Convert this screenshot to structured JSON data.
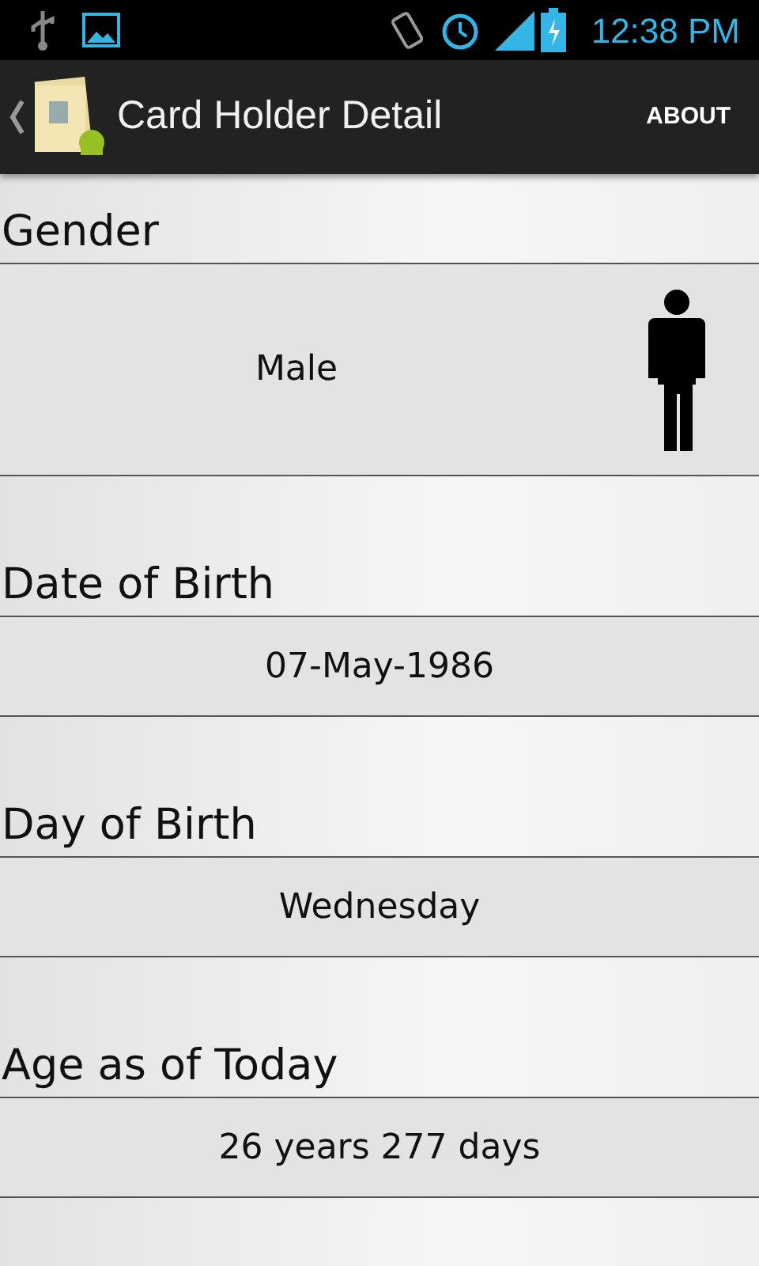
{
  "status_bar": {
    "time": "12:38 PM"
  },
  "action_bar": {
    "title": "Card Holder Detail",
    "action": "ABOUT"
  },
  "sections": [
    {
      "kind": "figure",
      "label": "Gender",
      "value": "Male"
    },
    {
      "kind": "plain",
      "label": "Date of Birth",
      "value": "07-May-1986"
    },
    {
      "kind": "plain",
      "label": "Day of Birth",
      "value": "Wednesday"
    },
    {
      "kind": "plain",
      "label": "Age as of Today",
      "value": "26 years 277 days"
    }
  ]
}
